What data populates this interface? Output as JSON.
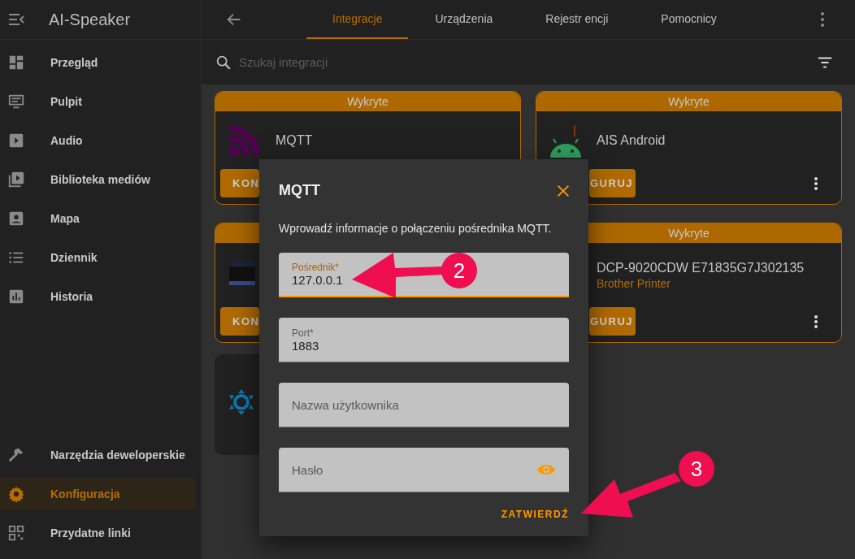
{
  "sidebar": {
    "title": "AI-Speaker",
    "items": [
      {
        "label": "Przegląd",
        "selected": false
      },
      {
        "label": "Pulpit",
        "selected": false
      },
      {
        "label": "Audio",
        "selected": false
      },
      {
        "label": "Biblioteka mediów",
        "selected": false
      },
      {
        "label": "Mapa",
        "selected": false
      },
      {
        "label": "Dziennik",
        "selected": false
      },
      {
        "label": "Historia",
        "selected": false
      }
    ],
    "bottom_items": [
      {
        "label": "Narzędzia deweloperskie",
        "selected": false
      },
      {
        "label": "Konfiguracja",
        "selected": true
      },
      {
        "label": "Przydatne linki",
        "selected": false
      }
    ]
  },
  "tabs": [
    {
      "label": "Integracje",
      "selected": true
    },
    {
      "label": "Urządzenia",
      "selected": false
    },
    {
      "label": "Rejestr encji",
      "selected": false
    },
    {
      "label": "Pomocnicy",
      "selected": false
    }
  ],
  "search": {
    "placeholder": "Szukaj integracji"
  },
  "card_rows": [
    {
      "cards": [
        {
          "discovered": true,
          "header": "Wykryte",
          "name": "MQTT",
          "button": "KON",
          "menu": false
        },
        {
          "discovered": true,
          "header": "Wykryte",
          "name": "AIS Android",
          "button": "GURUJ",
          "menu": true
        }
      ]
    },
    {
      "cards": [
        {
          "discovered": true,
          "button": "KON",
          "menu": false
        },
        {
          "discovered": true,
          "header": "Wykryte",
          "name": "DCP-9020CDW E71835G7J302135",
          "subtitle": "Brother Printer",
          "button": "GURUJ",
          "menu": true
        }
      ]
    },
    {
      "cards": [
        {
          "discovered": false,
          "menu": false
        }
      ]
    }
  ],
  "dialog": {
    "title": "MQTT",
    "description": "Wprowadź informacje o połączeniu pośrednika MQTT.",
    "fields": [
      {
        "label": "Pośrednik*",
        "value": "127.0.0.1",
        "focused": true
      },
      {
        "label": "Port*",
        "value": "1883",
        "focused": false
      },
      {
        "placeholder": "Nazwa użytkownika",
        "focused": false
      },
      {
        "placeholder": "Hasło",
        "focused": false,
        "kind": "password"
      }
    ],
    "submit": "ZATWIERDŹ"
  },
  "annotations": [
    {
      "label": "2"
    },
    {
      "label": "3"
    }
  ]
}
